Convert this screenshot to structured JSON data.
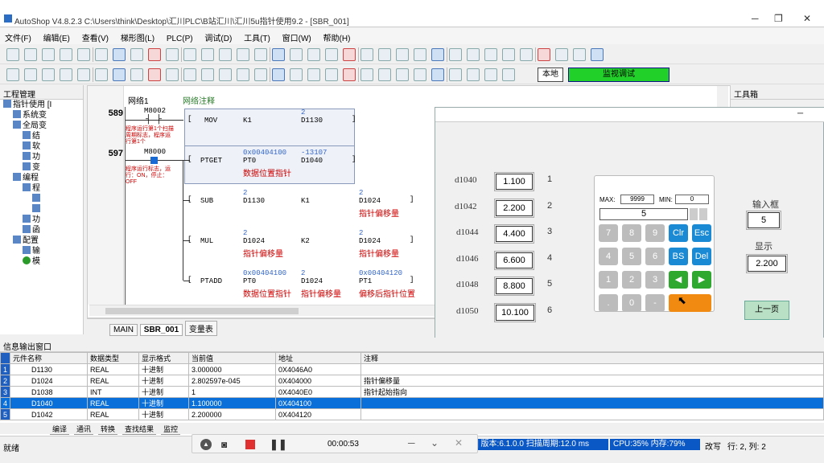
{
  "title": "AutoShop V4.8.2.3  C:\\Users\\think\\Desktop\\汇川PLC\\B站汇川\\汇川5u指针使用9.2 - [SBR_001]",
  "menu": [
    "文件(F)",
    "编辑(E)",
    "查看(V)",
    "梯形图(L)",
    "PLC(P)",
    "调试(D)",
    "工具(T)",
    "窗口(W)",
    "帮助(H)"
  ],
  "toolbar": {
    "local": "本地",
    "online": "监视调试"
  },
  "project": {
    "header": "工程管理",
    "items": [
      "指针使用 [I",
      "系统变",
      "全局变",
      "结",
      "软",
      "功",
      "变",
      "编程",
      "程",
      "功",
      "函",
      "配置",
      "输",
      "模"
    ]
  },
  "editor": {
    "network": "网络1",
    "comment": "网络注释",
    "rungs": [
      {
        "num": "589",
        "contact": "M8002",
        "note": "程序运行第1个扫描周期标志，程序运行第1个",
        "instr": "MOV",
        "op1": "K1",
        "op2top": "2",
        "op2": "D1130"
      },
      {
        "num": "597",
        "contact": "M8000",
        "note": "程序运行标志，运行：ON，停止：OFF",
        "rows": [
          {
            "instr": "PTGET",
            "op1top": "0x00404100",
            "op1": "PT0",
            "op1note": "数据位置指针",
            "op2top": "-13107",
            "op2": "D1040"
          },
          {
            "instr": "SUB",
            "op1top": "2",
            "op1": "D1130",
            "op2": "K1",
            "op3top": "2",
            "op3": "D1024",
            "op3note": "指针偏移量"
          },
          {
            "instr": "MUL",
            "op1top": "2",
            "op1": "D1024",
            "op1note": "指针偏移量",
            "op2": "K2",
            "op3top": "2",
            "op3": "D1024",
            "op3note": "指针偏移量"
          },
          {
            "instr": "PTADD",
            "op1top": "0x00404100",
            "op1": "PT0",
            "op1note": "数据位置指针",
            "op2top": "2",
            "op2": "D1024",
            "op2note": "指针偏移量",
            "op3top": "0x00404120",
            "op3": "PT1",
            "op3note": "偏移后指针位置"
          }
        ]
      }
    ]
  },
  "tabs": [
    "MAIN",
    "SBR_001",
    "变量表"
  ],
  "toolbox": {
    "header": "工具箱"
  },
  "dialog": {
    "rows": [
      {
        "label": "d1040",
        "value": "1.100",
        "idx": "1"
      },
      {
        "label": "d1042",
        "value": "2.200",
        "idx": "2"
      },
      {
        "label": "d1044",
        "value": "4.400",
        "idx": "3"
      },
      {
        "label": "d1046",
        "value": "6.600",
        "idx": "4"
      },
      {
        "label": "d1048",
        "value": "8.800",
        "idx": "5"
      },
      {
        "label": "d1050",
        "value": "10.100",
        "idx": "6"
      }
    ],
    "input_label": "输入框",
    "input_value": "5",
    "display_label": "显示",
    "display_value": "2.200",
    "prev_button": "上一页"
  },
  "keypad": {
    "max_label": "MAX:",
    "max": "9999",
    "min_label": "MIN:",
    "min": "0",
    "entry": "5",
    "keys": [
      "7",
      "8",
      "9",
      "Clr",
      "Esc",
      "4",
      "5",
      "6",
      "BS",
      "Del",
      "1",
      "2",
      "3",
      "◀",
      "▶",
      ".",
      "0",
      "-"
    ]
  },
  "info": {
    "header": "信息输出窗口",
    "columns": [
      "元件名称",
      "数据类型",
      "显示格式",
      "当前值",
      "地址",
      "注释"
    ],
    "rows": [
      {
        "n": "1",
        "name": "D1130",
        "type": "REAL",
        "fmt": "十进制",
        "val": "3.000000",
        "addr": "0X4046A0",
        "note": ""
      },
      {
        "n": "2",
        "name": "D1024",
        "type": "REAL",
        "fmt": "十进制",
        "val": "2.802597e-045",
        "addr": "0X404000",
        "note": "指针偏移量"
      },
      {
        "n": "3",
        "name": "D1038",
        "type": "INT",
        "fmt": "十进制",
        "val": "1",
        "addr": "0X4040E0",
        "note": "指针起始指向"
      },
      {
        "n": "4",
        "name": "D1040",
        "type": "REAL",
        "fmt": "十进制",
        "val": "1.100000",
        "addr": "0X404100",
        "note": ""
      },
      {
        "n": "5",
        "name": "D1042",
        "type": "REAL",
        "fmt": "十进制",
        "val": "2.200000",
        "addr": "0X404120",
        "note": ""
      }
    ],
    "bottom_tabs": [
      "编译",
      "通讯",
      "转换",
      "查找结果",
      "监控"
    ]
  },
  "status": {
    "left": "就绪",
    "timer": "00:00:53",
    "version": "] 版本:6.1.0.0 扫描周期:12.0 ms",
    "cpu": "CPU:35%  内存:79%",
    "mode": "改写",
    "pos": "行: 2, 列: 2"
  }
}
